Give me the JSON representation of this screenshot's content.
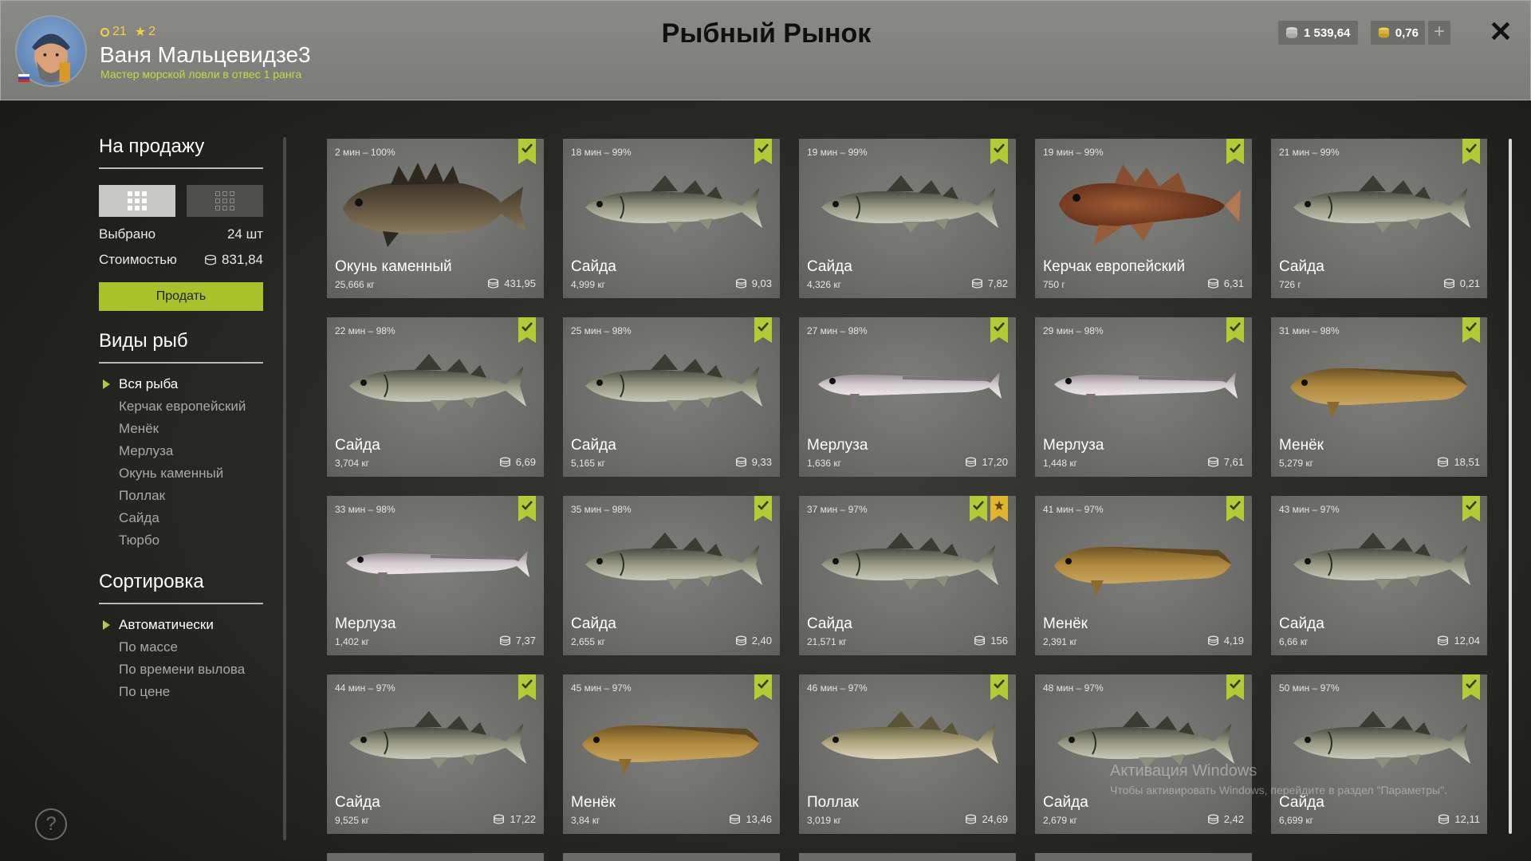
{
  "header": {
    "title": "Рыбный Рынок",
    "player": {
      "name": "Ваня Мальцевидзе3",
      "rank": "Мастер морской ловли в отвес 1 ранга",
      "level": "21",
      "stars": "2"
    },
    "currency": [
      {
        "icon": "silver-coin-icon",
        "value": "1 539,64"
      },
      {
        "icon": "gold-coin-icon",
        "value": "0,76"
      }
    ],
    "add_currency_label": "+",
    "close_label": "✕"
  },
  "sidebar": {
    "for_sale_title": "На продажу",
    "selected_label": "Выбрано",
    "selected_value": "24 шт",
    "cost_label": "Стоимостью",
    "cost_value": "831,84",
    "sell_label": "Продать",
    "species_title": "Виды рыб",
    "species": [
      {
        "label": "Вся рыба",
        "selected": true
      },
      {
        "label": "Керчак европейский",
        "selected": false
      },
      {
        "label": "Менёк",
        "selected": false
      },
      {
        "label": "Мерлуза",
        "selected": false
      },
      {
        "label": "Окунь каменный",
        "selected": false
      },
      {
        "label": "Поллак",
        "selected": false
      },
      {
        "label": "Сайда",
        "selected": false
      },
      {
        "label": "Тюрбо",
        "selected": false
      }
    ],
    "sort_title": "Сортировка",
    "sort": [
      {
        "label": "Автоматически",
        "selected": true
      },
      {
        "label": "По массе",
        "selected": false
      },
      {
        "label": "По времени вылова",
        "selected": false
      },
      {
        "label": "По цене",
        "selected": false
      }
    ],
    "help_label": "?"
  },
  "fish": [
    {
      "time": "2 мин – 100%",
      "name": "Окунь каменный",
      "weight": "25,666 кг",
      "price": "431,95",
      "kind": "rockfish",
      "marks": [
        "check"
      ]
    },
    {
      "time": "18 мин – 99%",
      "name": "Сайда",
      "weight": "4,999 кг",
      "price": "9,03",
      "kind": "saithe",
      "marks": [
        "check"
      ]
    },
    {
      "time": "19 мин – 99%",
      "name": "Сайда",
      "weight": "4,326 кг",
      "price": "7,82",
      "kind": "saithe",
      "marks": [
        "check"
      ]
    },
    {
      "time": "19 мин – 99%",
      "name": "Керчак европейский",
      "weight": "750 г",
      "price": "6,31",
      "kind": "sculpin",
      "marks": [
        "check"
      ]
    },
    {
      "time": "21 мин – 99%",
      "name": "Сайда",
      "weight": "726 г",
      "price": "0,21",
      "kind": "saithe",
      "marks": [
        "check"
      ]
    },
    {
      "time": "22 мин – 98%",
      "name": "Сайда",
      "weight": "3,704 кг",
      "price": "6,69",
      "kind": "saithe",
      "marks": [
        "check"
      ]
    },
    {
      "time": "25 мин – 98%",
      "name": "Сайда",
      "weight": "5,165 кг",
      "price": "9,33",
      "kind": "saithe",
      "marks": [
        "check"
      ]
    },
    {
      "time": "27 мин – 98%",
      "name": "Мерлуза",
      "weight": "1,636 кг",
      "price": "17,20",
      "kind": "hake",
      "marks": [
        "check"
      ]
    },
    {
      "time": "29 мин – 98%",
      "name": "Мерлуза",
      "weight": "1,448 кг",
      "price": "7,61",
      "kind": "hake",
      "marks": [
        "check"
      ]
    },
    {
      "time": "31 мин – 98%",
      "name": "Менёк",
      "weight": "5,279 кг",
      "price": "18,51",
      "kind": "tusk",
      "marks": [
        "check"
      ]
    },
    {
      "time": "33 мин – 98%",
      "name": "Мерлуза",
      "weight": "1,402 кг",
      "price": "7,37",
      "kind": "hake",
      "marks": [
        "check"
      ]
    },
    {
      "time": "35 мин – 98%",
      "name": "Сайда",
      "weight": "2,655 кг",
      "price": "2,40",
      "kind": "saithe",
      "marks": [
        "check"
      ]
    },
    {
      "time": "37 мин – 97%",
      "name": "Сайда",
      "weight": "21,571 кг",
      "price": "156",
      "kind": "saithe",
      "marks": [
        "check",
        "star"
      ]
    },
    {
      "time": "41 мин – 97%",
      "name": "Менёк",
      "weight": "2,391 кг",
      "price": "4,19",
      "kind": "tusk",
      "marks": [
        "check"
      ]
    },
    {
      "time": "43 мин – 97%",
      "name": "Сайда",
      "weight": "6,66 кг",
      "price": "12,04",
      "kind": "saithe",
      "marks": [
        "check"
      ]
    },
    {
      "time": "44 мин – 97%",
      "name": "Сайда",
      "weight": "9,525 кг",
      "price": "17,22",
      "kind": "saithe",
      "marks": [
        "check"
      ]
    },
    {
      "time": "45 мин – 97%",
      "name": "Менёк",
      "weight": "3,84 кг",
      "price": "13,46",
      "kind": "tusk",
      "marks": [
        "check"
      ]
    },
    {
      "time": "46 мин – 97%",
      "name": "Поллак",
      "weight": "3,019 кг",
      "price": "24,69",
      "kind": "pollack",
      "marks": [
        "check"
      ]
    },
    {
      "time": "48 мин – 97%",
      "name": "Сайда",
      "weight": "2,679 кг",
      "price": "2,42",
      "kind": "saithe",
      "marks": [
        "check"
      ]
    },
    {
      "time": "50 мин – 97%",
      "name": "Сайда",
      "weight": "6,699 кг",
      "price": "12,11",
      "kind": "saithe",
      "marks": [
        "check"
      ]
    }
  ],
  "watermark": {
    "line1": "Активация Windows",
    "line2": "Чтобы активировать Windows, перейдите в раздел \"Параметры\"."
  }
}
